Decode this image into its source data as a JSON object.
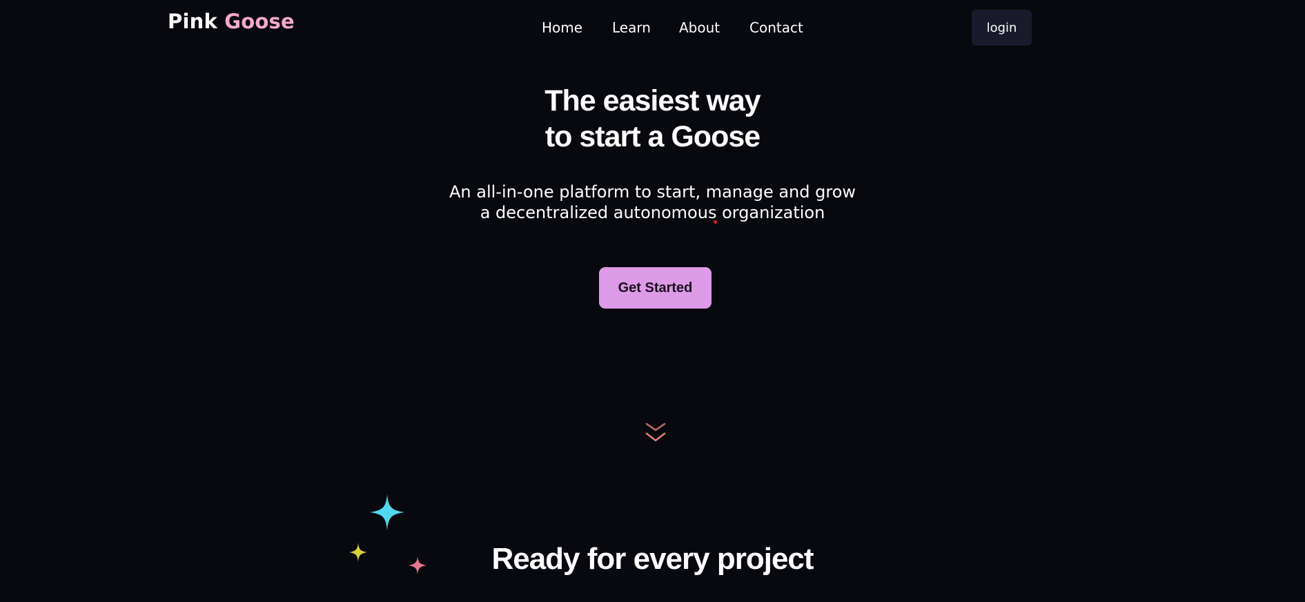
{
  "brand": {
    "first": "Pink",
    "second": "Goose"
  },
  "nav": {
    "items": [
      "Home",
      "Learn",
      "About",
      "Contact"
    ]
  },
  "login_label": "login",
  "hero": {
    "title_line1": "The easiest way",
    "title_line2": "to start a Goose",
    "subtitle_line1": "An all-in-one platform to start, manage and grow",
    "subtitle_line2": "a decentralized autonomous organization",
    "cta_label": "Get Started"
  },
  "scroll_icon": "double-chevron-down-icon",
  "section": {
    "title": "Ready for every project"
  },
  "colors": {
    "background": "#08090e",
    "brand_pink": "#f4a9cc",
    "cta_bg": "#dd9ae6",
    "login_bg": "#1a1a2c",
    "chevron": "#d4766c",
    "sparkle_cyan": "#4fd8ef",
    "sparkle_yellow": "#d7d23a",
    "sparkle_pink": "#e8768f"
  }
}
